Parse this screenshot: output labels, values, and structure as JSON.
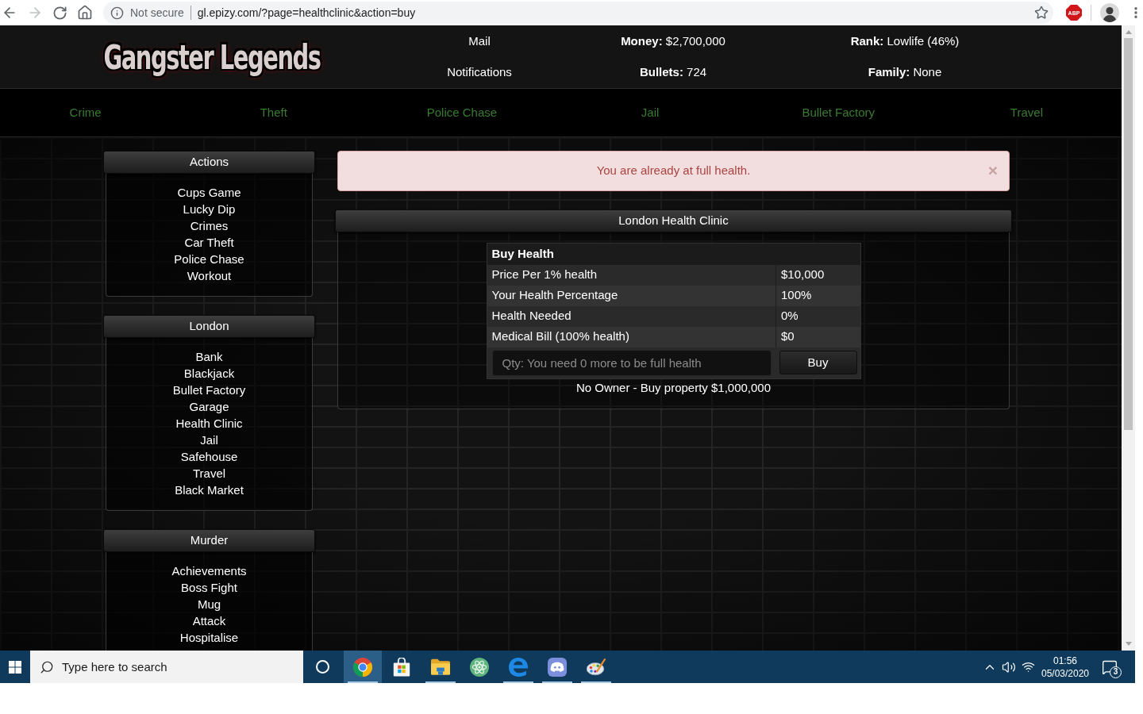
{
  "browser": {
    "forward_disabled": true,
    "security_label": "Not secure",
    "url": "gl.epizy.com/?page=healthclinic&action=buy",
    "extension_badge": "ABP"
  },
  "header": {
    "logo": "Gangster Legends",
    "links": [
      "Mail",
      "Notifications"
    ],
    "stats": [
      "**Money:** $2,700,000",
      "**Bullets:** 724",
      "**Rank:** Lowlife (46%)",
      "**Family:** None"
    ]
  },
  "nav": [
    "Crime",
    "Theft",
    "Police Chase",
    "Jail",
    "Bullet Factory",
    "Travel"
  ],
  "sidebar": [
    {
      "title": "Actions",
      "items": [
        "Cups Game",
        "Lucky Dip",
        "Crimes",
        "Car Theft",
        "Police Chase",
        "Workout"
      ]
    },
    {
      "title": "London",
      "items": [
        "Bank",
        "Blackjack",
        "Bullet Factory",
        "Garage",
        "Health Clinic",
        "Jail",
        "Safehouse",
        "Travel",
        "Black Market"
      ]
    },
    {
      "title": "Murder",
      "items": [
        "Achievements",
        "Boss Fight",
        "Mug",
        "Attack",
        "Hospitalise"
      ]
    }
  ],
  "alert": {
    "message": "You are already at full health.",
    "close": "×"
  },
  "clinic": {
    "title": "London Health Clinic",
    "table": {
      "heading": "Buy Health",
      "rows": [
        {
          "label": "Price Per 1% health",
          "value": "$10,000"
        },
        {
          "label": "Your Health Percentage",
          "value": "100%"
        },
        {
          "label": "Health Needed",
          "value": "0%"
        },
        {
          "label": "Medical Bill (100% health)",
          "value": "$0"
        }
      ]
    },
    "quantity_field": {
      "placeholder": "Qty: You need 0 more to be full health"
    },
    "buy_button": "Buy",
    "ownership": "No Owner - Buy property $1,000,000"
  },
  "taskbar": {
    "search": {
      "placeholder": "Type here to search"
    },
    "apps": [
      {
        "kind": "chrome",
        "running": true,
        "selected": true
      },
      {
        "kind": "store",
        "running": false,
        "selected": false
      },
      {
        "kind": "explorer",
        "running": true,
        "selected": false
      },
      {
        "kind": "atom",
        "running": false,
        "selected": false
      },
      {
        "kind": "edge",
        "running": true,
        "selected": false
      },
      {
        "kind": "discord",
        "running": true,
        "selected": false
      },
      {
        "kind": "paint",
        "running": true,
        "selected": false
      }
    ],
    "time": "01:56",
    "date": "05/03/2020",
    "notification_count": "3"
  }
}
